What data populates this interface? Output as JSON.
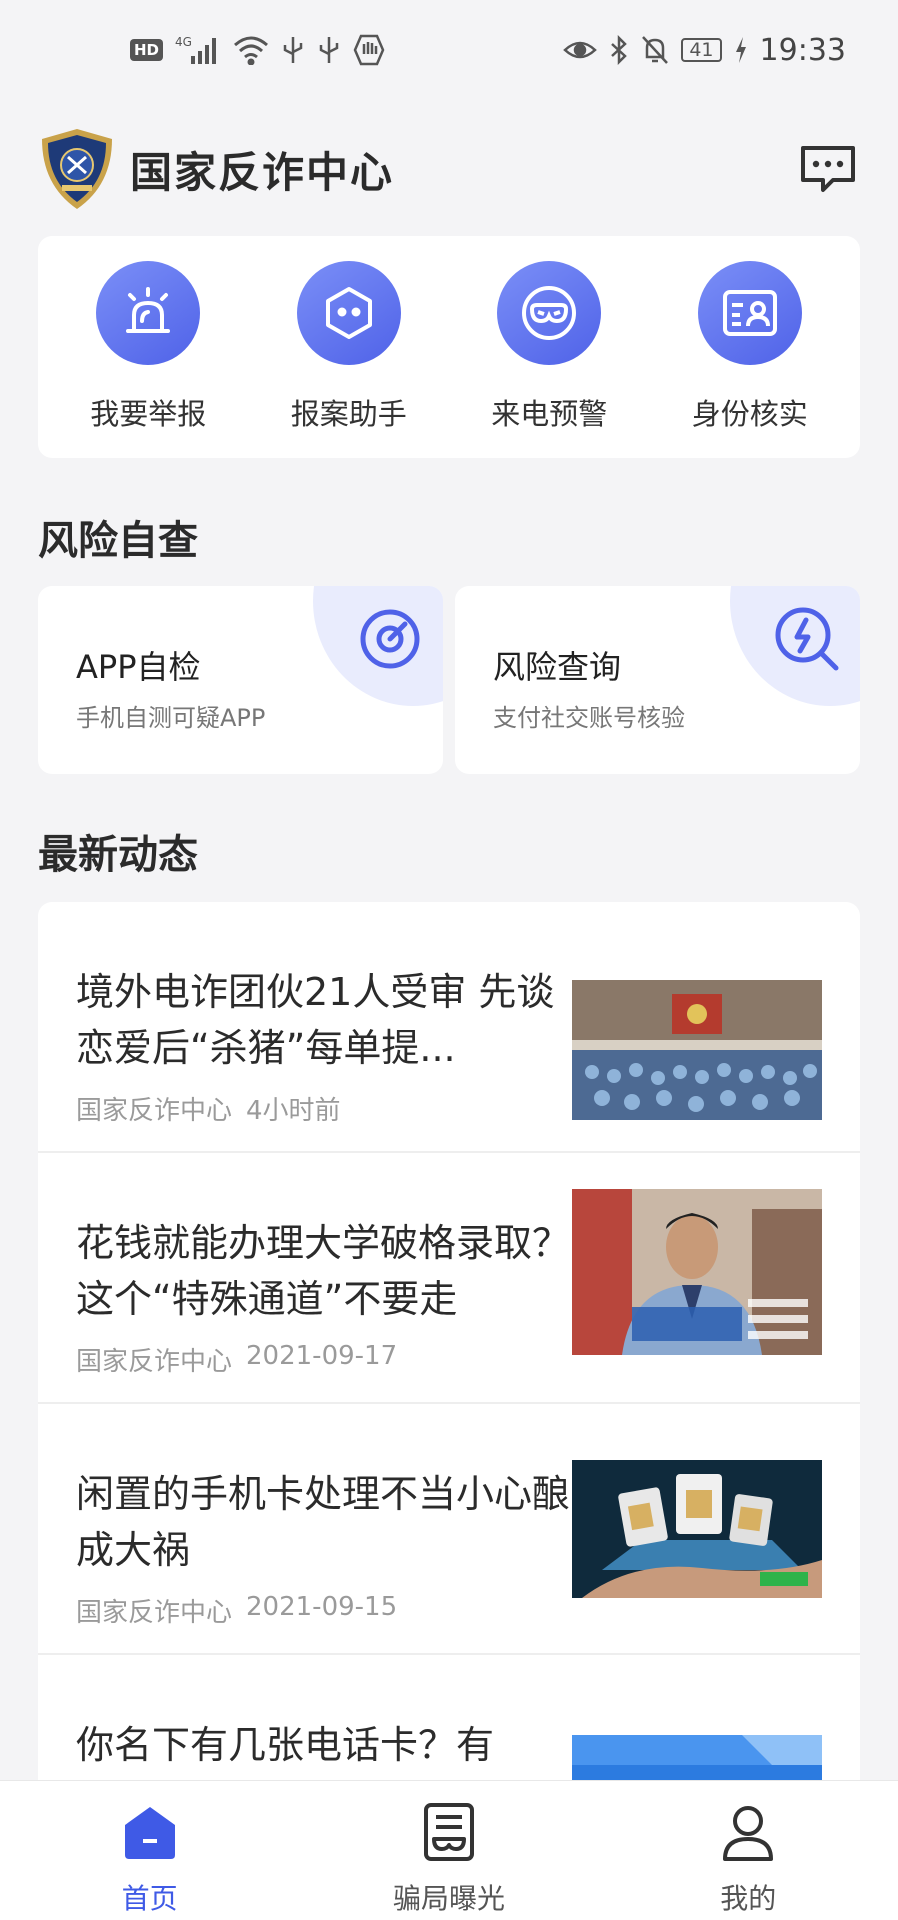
{
  "status_bar": {
    "left_icons": [
      "hd-icon",
      "signal-4g-icon",
      "wifi-icon",
      "usb-icon",
      "usb-icon",
      "hand-icon"
    ],
    "hd_label": "HD",
    "network_label": "4G",
    "right_icons": [
      "eye-icon",
      "bluetooth-icon",
      "mute-bell-icon",
      "battery-icon",
      "charging-icon"
    ],
    "battery": "41",
    "time": "19:33"
  },
  "header": {
    "title": "国家反诈中心",
    "logo": "police-badge-logo",
    "message_icon": "message-icon"
  },
  "quick_actions": [
    {
      "label": "我要举报",
      "icon": "alarm-light-icon"
    },
    {
      "label": "报案助手",
      "icon": "hexagon-face-icon"
    },
    {
      "label": "来电预警",
      "icon": "mask-icon"
    },
    {
      "label": "身份核实",
      "icon": "id-card-icon"
    }
  ],
  "risk_section": {
    "title": "风险自查",
    "cards": [
      {
        "title": "APP自检",
        "subtitle": "手机自测可疑APP",
        "icon": "target-icon"
      },
      {
        "title": "风险查询",
        "subtitle": "支付社交账号核验",
        "icon": "search-lightning-icon"
      }
    ]
  },
  "news_section": {
    "title": "最新动态",
    "items": [
      {
        "title": "境外电诈团伙21人受审  先谈恋爱后“杀猪”每单提...",
        "source": "国家反诈中心",
        "time": "4小时前",
        "thumb": "courtroom-photo"
      },
      {
        "title": "花钱就能办理大学破格录取？这个“特殊通道”不要走",
        "source": "国家反诈中心",
        "time": "2021-09-17",
        "thumb": "police-officer-interview-photo"
      },
      {
        "title": "闲置的手机卡处理不当小心酿成大祸",
        "source": "国家反诈中心",
        "time": "2021-09-15",
        "thumb": "sim-card-phone-photo"
      },
      {
        "title": "你名下有几张电话卡？有",
        "source": "",
        "time": "",
        "thumb": "blue-banner-photo"
      }
    ]
  },
  "bottom_nav": [
    {
      "label": "首页",
      "icon": "home-icon",
      "active": true
    },
    {
      "label": "骗局曝光",
      "icon": "exposure-icon",
      "active": false
    },
    {
      "label": "我的",
      "icon": "user-icon",
      "active": false
    }
  ],
  "colors": {
    "accent": "#4f62e8",
    "accent_light": "#e9ecfd",
    "background": "#f4f4f6"
  }
}
